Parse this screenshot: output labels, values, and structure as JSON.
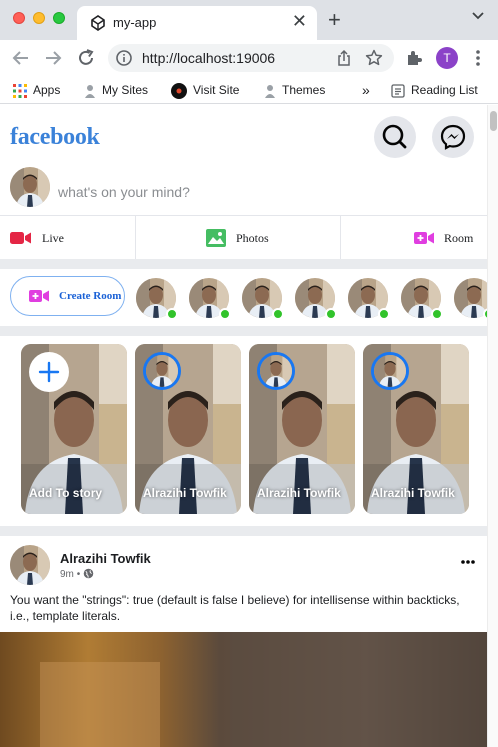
{
  "browser": {
    "tab_title": "my-app",
    "url": "http://localhost:19006",
    "profile_initial": "T",
    "bookmarks": [
      {
        "label": "Apps",
        "icon": "apps-grid-icon"
      },
      {
        "label": "My Sites",
        "icon": "person-icon"
      },
      {
        "label": "Visit Site",
        "icon": "site-logo-icon"
      },
      {
        "label": "Themes",
        "icon": "person-icon"
      }
    ],
    "more_bookmarks": "»",
    "reading_list": "Reading List"
  },
  "header": {
    "logo": "facebook"
  },
  "composer": {
    "placeholder": "what's on your mind?"
  },
  "actions": [
    {
      "label": "Live",
      "icon": "video-camera-icon",
      "color": "#e42645"
    },
    {
      "label": "Photos",
      "icon": "photo-icon",
      "color": "#45bd62"
    },
    {
      "label": "Room",
      "icon": "video-room-icon",
      "color": "#e03ee0"
    }
  ],
  "rooms": {
    "create_label": "Create Room",
    "online_color": "#31c32b"
  },
  "stories": [
    {
      "name": "Add To story",
      "type": "add"
    },
    {
      "name": "Alrazihi Towfik",
      "type": "user"
    },
    {
      "name": "Alrazihi Towfik",
      "type": "user"
    },
    {
      "name": "Alrazihi Towfik",
      "type": "user"
    }
  ],
  "post": {
    "author": "Alrazihi Towfik",
    "time": "9m",
    "separator": "•",
    "text": "You want the \"strings\": true (default is false I believe) for intellisense within backticks, i.e., template literals."
  },
  "colors": {
    "brand": "#3b82d9",
    "story_ring": "#1877f2",
    "page_gap": "#e9ebee"
  }
}
